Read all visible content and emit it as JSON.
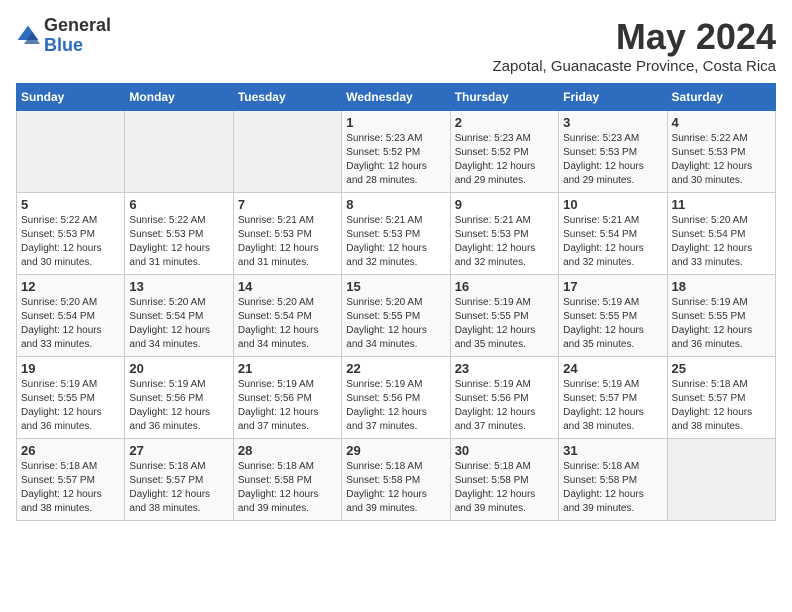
{
  "logo": {
    "general": "General",
    "blue": "Blue"
  },
  "header": {
    "month": "May 2024",
    "location": "Zapotal, Guanacaste Province, Costa Rica"
  },
  "days_of_week": [
    "Sunday",
    "Monday",
    "Tuesday",
    "Wednesday",
    "Thursday",
    "Friday",
    "Saturday"
  ],
  "weeks": [
    [
      {
        "day": "",
        "sunrise": "",
        "sunset": "",
        "daylight": ""
      },
      {
        "day": "",
        "sunrise": "",
        "sunset": "",
        "daylight": ""
      },
      {
        "day": "",
        "sunrise": "",
        "sunset": "",
        "daylight": ""
      },
      {
        "day": "1",
        "sunrise": "Sunrise: 5:23 AM",
        "sunset": "Sunset: 5:52 PM",
        "daylight": "Daylight: 12 hours and 28 minutes."
      },
      {
        "day": "2",
        "sunrise": "Sunrise: 5:23 AM",
        "sunset": "Sunset: 5:52 PM",
        "daylight": "Daylight: 12 hours and 29 minutes."
      },
      {
        "day": "3",
        "sunrise": "Sunrise: 5:23 AM",
        "sunset": "Sunset: 5:53 PM",
        "daylight": "Daylight: 12 hours and 29 minutes."
      },
      {
        "day": "4",
        "sunrise": "Sunrise: 5:22 AM",
        "sunset": "Sunset: 5:53 PM",
        "daylight": "Daylight: 12 hours and 30 minutes."
      }
    ],
    [
      {
        "day": "5",
        "sunrise": "Sunrise: 5:22 AM",
        "sunset": "Sunset: 5:53 PM",
        "daylight": "Daylight: 12 hours and 30 minutes."
      },
      {
        "day": "6",
        "sunrise": "Sunrise: 5:22 AM",
        "sunset": "Sunset: 5:53 PM",
        "daylight": "Daylight: 12 hours and 31 minutes."
      },
      {
        "day": "7",
        "sunrise": "Sunrise: 5:21 AM",
        "sunset": "Sunset: 5:53 PM",
        "daylight": "Daylight: 12 hours and 31 minutes."
      },
      {
        "day": "8",
        "sunrise": "Sunrise: 5:21 AM",
        "sunset": "Sunset: 5:53 PM",
        "daylight": "Daylight: 12 hours and 32 minutes."
      },
      {
        "day": "9",
        "sunrise": "Sunrise: 5:21 AM",
        "sunset": "Sunset: 5:53 PM",
        "daylight": "Daylight: 12 hours and 32 minutes."
      },
      {
        "day": "10",
        "sunrise": "Sunrise: 5:21 AM",
        "sunset": "Sunset: 5:54 PM",
        "daylight": "Daylight: 12 hours and 32 minutes."
      },
      {
        "day": "11",
        "sunrise": "Sunrise: 5:20 AM",
        "sunset": "Sunset: 5:54 PM",
        "daylight": "Daylight: 12 hours and 33 minutes."
      }
    ],
    [
      {
        "day": "12",
        "sunrise": "Sunrise: 5:20 AM",
        "sunset": "Sunset: 5:54 PM",
        "daylight": "Daylight: 12 hours and 33 minutes."
      },
      {
        "day": "13",
        "sunrise": "Sunrise: 5:20 AM",
        "sunset": "Sunset: 5:54 PM",
        "daylight": "Daylight: 12 hours and 34 minutes."
      },
      {
        "day": "14",
        "sunrise": "Sunrise: 5:20 AM",
        "sunset": "Sunset: 5:54 PM",
        "daylight": "Daylight: 12 hours and 34 minutes."
      },
      {
        "day": "15",
        "sunrise": "Sunrise: 5:20 AM",
        "sunset": "Sunset: 5:55 PM",
        "daylight": "Daylight: 12 hours and 34 minutes."
      },
      {
        "day": "16",
        "sunrise": "Sunrise: 5:19 AM",
        "sunset": "Sunset: 5:55 PM",
        "daylight": "Daylight: 12 hours and 35 minutes."
      },
      {
        "day": "17",
        "sunrise": "Sunrise: 5:19 AM",
        "sunset": "Sunset: 5:55 PM",
        "daylight": "Daylight: 12 hours and 35 minutes."
      },
      {
        "day": "18",
        "sunrise": "Sunrise: 5:19 AM",
        "sunset": "Sunset: 5:55 PM",
        "daylight": "Daylight: 12 hours and 36 minutes."
      }
    ],
    [
      {
        "day": "19",
        "sunrise": "Sunrise: 5:19 AM",
        "sunset": "Sunset: 5:55 PM",
        "daylight": "Daylight: 12 hours and 36 minutes."
      },
      {
        "day": "20",
        "sunrise": "Sunrise: 5:19 AM",
        "sunset": "Sunset: 5:56 PM",
        "daylight": "Daylight: 12 hours and 36 minutes."
      },
      {
        "day": "21",
        "sunrise": "Sunrise: 5:19 AM",
        "sunset": "Sunset: 5:56 PM",
        "daylight": "Daylight: 12 hours and 37 minutes."
      },
      {
        "day": "22",
        "sunrise": "Sunrise: 5:19 AM",
        "sunset": "Sunset: 5:56 PM",
        "daylight": "Daylight: 12 hours and 37 minutes."
      },
      {
        "day": "23",
        "sunrise": "Sunrise: 5:19 AM",
        "sunset": "Sunset: 5:56 PM",
        "daylight": "Daylight: 12 hours and 37 minutes."
      },
      {
        "day": "24",
        "sunrise": "Sunrise: 5:19 AM",
        "sunset": "Sunset: 5:57 PM",
        "daylight": "Daylight: 12 hours and 38 minutes."
      },
      {
        "day": "25",
        "sunrise": "Sunrise: 5:18 AM",
        "sunset": "Sunset: 5:57 PM",
        "daylight": "Daylight: 12 hours and 38 minutes."
      }
    ],
    [
      {
        "day": "26",
        "sunrise": "Sunrise: 5:18 AM",
        "sunset": "Sunset: 5:57 PM",
        "daylight": "Daylight: 12 hours and 38 minutes."
      },
      {
        "day": "27",
        "sunrise": "Sunrise: 5:18 AM",
        "sunset": "Sunset: 5:57 PM",
        "daylight": "Daylight: 12 hours and 38 minutes."
      },
      {
        "day": "28",
        "sunrise": "Sunrise: 5:18 AM",
        "sunset": "Sunset: 5:58 PM",
        "daylight": "Daylight: 12 hours and 39 minutes."
      },
      {
        "day": "29",
        "sunrise": "Sunrise: 5:18 AM",
        "sunset": "Sunset: 5:58 PM",
        "daylight": "Daylight: 12 hours and 39 minutes."
      },
      {
        "day": "30",
        "sunrise": "Sunrise: 5:18 AM",
        "sunset": "Sunset: 5:58 PM",
        "daylight": "Daylight: 12 hours and 39 minutes."
      },
      {
        "day": "31",
        "sunrise": "Sunrise: 5:18 AM",
        "sunset": "Sunset: 5:58 PM",
        "daylight": "Daylight: 12 hours and 39 minutes."
      },
      {
        "day": "",
        "sunrise": "",
        "sunset": "",
        "daylight": ""
      }
    ]
  ]
}
